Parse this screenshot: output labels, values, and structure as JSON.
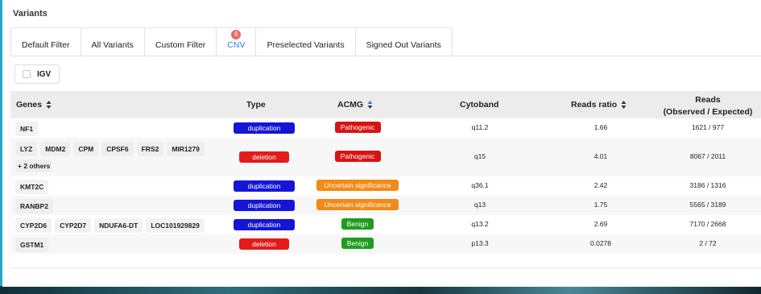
{
  "section_title": "Variants",
  "tabs": [
    {
      "label": "Default Filter"
    },
    {
      "label": "All Variants"
    },
    {
      "label": "Custom Filter"
    },
    {
      "label": "CNV",
      "badge": "6",
      "active": true
    },
    {
      "label": "Preselected Variants"
    },
    {
      "label": "Signed Out Variants"
    }
  ],
  "igv": {
    "label": "IGV",
    "checked": false
  },
  "columns": {
    "genes": "Genes",
    "type": "Type",
    "acmg": "ACMG",
    "cytoband": "Cytoband",
    "reads_ratio": "Reads ratio",
    "reads_line1": "Reads",
    "reads_line2": "(Observed / Expected)"
  },
  "colors": {
    "duplication": "#1515d6",
    "deletion": "#e31b1b",
    "pathogenic": "#d81313",
    "uncertain": "#f28a16",
    "benign": "#1f9c1f",
    "active_tab": "#2b7fd9",
    "badge": "#e96a6a"
  },
  "rows": [
    {
      "genes": [
        "NF1"
      ],
      "more": "",
      "type": "duplication",
      "acmg": "Pathogenic",
      "acmg_class": "pathogenic",
      "cytoband": "q11.2",
      "reads_ratio": "1.66",
      "reads": "1621 / 977"
    },
    {
      "genes": [
        "LYZ",
        "MDM2",
        "CPM",
        "CPSF6",
        "FRS2",
        "MIR1279"
      ],
      "more": "+ 2 others",
      "type": "deletion",
      "acmg": "Pathogenic",
      "acmg_class": "pathogenic",
      "cytoband": "q15",
      "reads_ratio": "4.01",
      "reads": "8067 / 2011"
    },
    {
      "genes": [
        "KMT2C"
      ],
      "more": "",
      "type": "duplication",
      "acmg": "Uncertain significance",
      "acmg_class": "uncertain",
      "cytoband": "q36.1",
      "reads_ratio": "2.42",
      "reads": "3186 / 1316"
    },
    {
      "genes": [
        "RANBP2"
      ],
      "more": "",
      "type": "duplication",
      "acmg": "Uncertain significance",
      "acmg_class": "uncertain",
      "cytoband": "q13",
      "reads_ratio": "1.75",
      "reads": "5565 / 3189"
    },
    {
      "genes": [
        "CYP2D6",
        "CYP2D7",
        "NDUFA6-DT",
        "LOC101929829"
      ],
      "more": "",
      "type": "duplication",
      "acmg": "Benign",
      "acmg_class": "benign",
      "cytoband": "q13.2",
      "reads_ratio": "2.69",
      "reads": "7170 / 2668"
    },
    {
      "genes": [
        "GSTM1"
      ],
      "more": "",
      "type": "deletion",
      "acmg": "Benign",
      "acmg_class": "benign",
      "cytoband": "p13.3",
      "reads_ratio": "0.0278",
      "reads": "2 / 72"
    }
  ]
}
